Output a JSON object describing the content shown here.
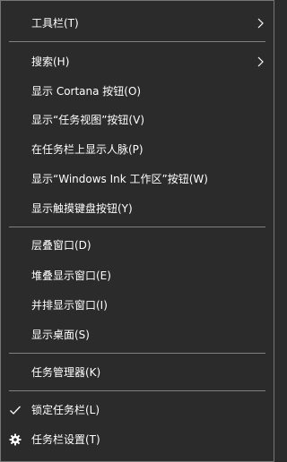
{
  "menu": {
    "toolbars": "工具栏(T)",
    "search": "搜索(H)",
    "show_cortana": "显示 Cortana 按钮(O)",
    "show_task_view": "显示“任务视图”按钮(V)",
    "show_people": "在任务栏上显示人脉(P)",
    "show_ink": "显示“Windows Ink 工作区”按钮(W)",
    "show_touch_keyboard": "显示触摸键盘按钮(Y)",
    "cascade": "层叠窗口(D)",
    "stacked": "堆叠显示窗口(E)",
    "side_by_side": "并排显示窗口(I)",
    "show_desktop": "显示桌面(S)",
    "task_manager": "任务管理器(K)",
    "lock_taskbar": "锁定任务栏(L)",
    "taskbar_settings": "任务栏设置(T)"
  },
  "icons": {
    "submenu": "chevron-right-icon",
    "checked": "checkmark-icon",
    "settings": "gear-icon"
  },
  "colors": {
    "background": "#2b2b2b",
    "text": "#ffffff",
    "separator": "#808080",
    "border": "#767676"
  }
}
